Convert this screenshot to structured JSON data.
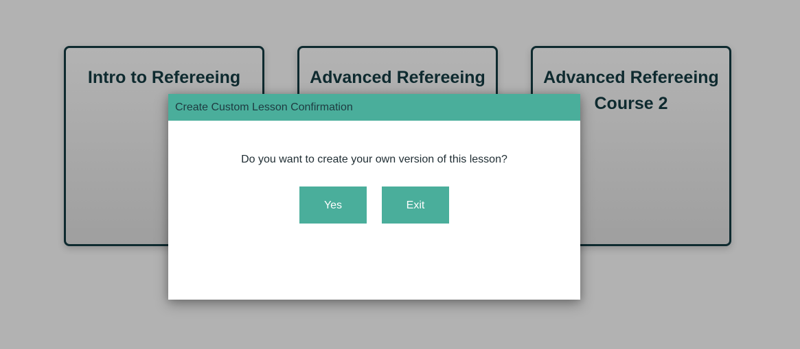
{
  "courses": [
    {
      "title": "Intro to Refereeing"
    },
    {
      "title": "Advanced Refereeing 3"
    },
    {
      "title": "Advanced Refereeing Course 2"
    }
  ],
  "dialog": {
    "title": "Create Custom Lesson Confirmation",
    "message": "Do you want to create your own version of this lesson?",
    "yes_label": "Yes",
    "exit_label": "Exit"
  },
  "colors": {
    "accent": "#4aae9b",
    "card_border": "#0e2a2f",
    "backdrop": "#b2b2b2"
  }
}
